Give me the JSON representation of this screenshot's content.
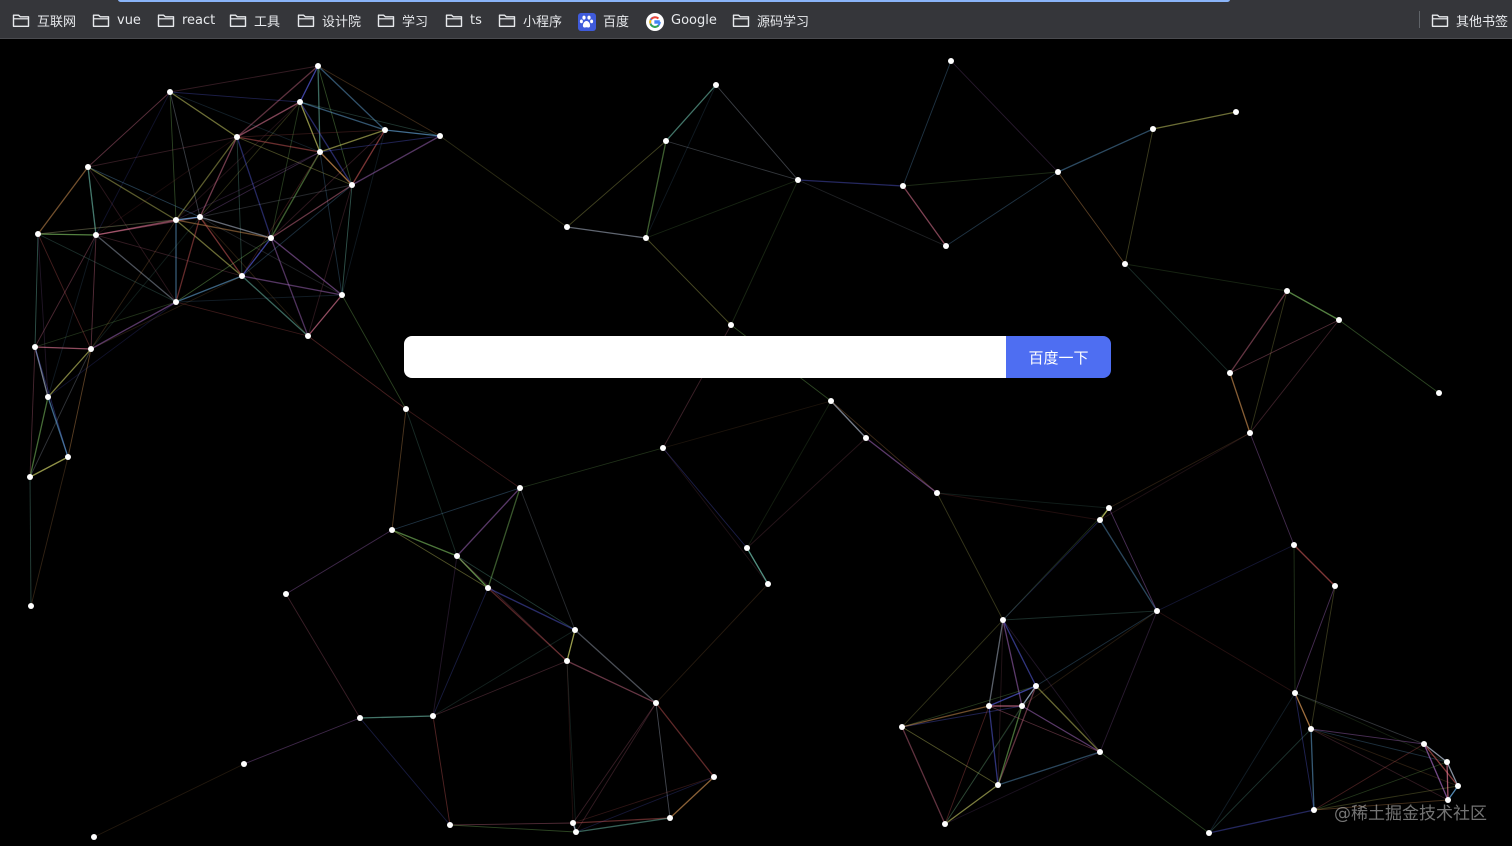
{
  "bookmarks": [
    {
      "label": "互联网",
      "icon": "folder-icon"
    },
    {
      "label": "vue",
      "icon": "folder-icon"
    },
    {
      "label": "react",
      "icon": "folder-icon"
    },
    {
      "label": "工具",
      "icon": "folder-icon"
    },
    {
      "label": "设计院",
      "icon": "folder-icon"
    },
    {
      "label": "学习",
      "icon": "folder-icon"
    },
    {
      "label": "ts",
      "icon": "folder-icon"
    },
    {
      "label": "小程序",
      "icon": "folder-icon"
    },
    {
      "label": "百度",
      "icon": "baidu-paw-icon"
    },
    {
      "label": "Google",
      "icon": "google-g-icon"
    },
    {
      "label": "源码学习",
      "icon": "folder-icon"
    }
  ],
  "other_bookmarks": {
    "label": "其他书签",
    "icon": "folder-icon"
  },
  "search": {
    "value": "",
    "placeholder": "",
    "button_label": "百度一下"
  },
  "watermark": "@稀土掘金技术社区",
  "colors": {
    "bookmarks_bar": "#35363a",
    "background": "#000000",
    "search_button": "#4e6ef2",
    "tab_indicator": "#8ab4f8"
  }
}
